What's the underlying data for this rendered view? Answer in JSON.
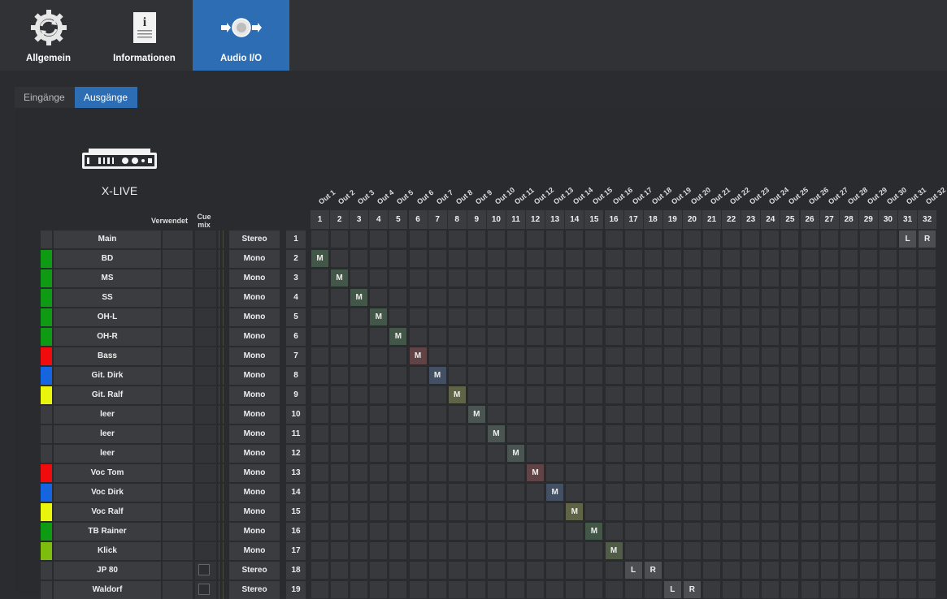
{
  "toolbar": {
    "items": [
      {
        "label": "Allgemein",
        "icon": "sync-gear-icon",
        "active": false
      },
      {
        "label": "Informationen",
        "icon": "info-document-icon",
        "active": false
      },
      {
        "label": "Audio I/O",
        "icon": "audio-io-icon",
        "active": true
      }
    ]
  },
  "tabs": [
    {
      "label": "Eingänge",
      "active": false
    },
    {
      "label": "Ausgänge",
      "active": true
    }
  ],
  "device": {
    "name": "X-LIVE",
    "icon": "rack-device-icon"
  },
  "headers": {
    "used": "Verwendet",
    "cue_mix": "Cue mix"
  },
  "outputs": {
    "labels": [
      "Out 1",
      "Out 2",
      "Out 3",
      "Out 4",
      "Out 5",
      "Out 6",
      "Out 7",
      "Out 8",
      "Out 9",
      "Out 10",
      "Out 11",
      "Out 12",
      "Out 13",
      "Out 14",
      "Out 15",
      "Out 16",
      "Out 17",
      "Out 18",
      "Out 19",
      "Out 20",
      "Out 21",
      "Out 22",
      "Out 23",
      "Out 24",
      "Out 25",
      "Out 26",
      "Out 27",
      "Out 28",
      "Out 29",
      "Out 30",
      "Out 31",
      "Out 32"
    ],
    "numbers": [
      "1",
      "2",
      "3",
      "4",
      "5",
      "6",
      "7",
      "8",
      "9",
      "10",
      "11",
      "12",
      "13",
      "14",
      "15",
      "16",
      "17",
      "18",
      "19",
      "20",
      "21",
      "22",
      "23",
      "24",
      "25",
      "26",
      "27",
      "28",
      "29",
      "30",
      "31",
      "32"
    ]
  },
  "colors": {
    "accent": "#2d6db4",
    "green": "#0f9a14",
    "red": "#f00c0c",
    "blue": "#1565e0",
    "yellow": "#eaf50d",
    "lime": "#7dbd0e"
  },
  "channels": [
    {
      "name": "Main",
      "color": "",
      "mode": "Stereo",
      "num": "1",
      "cue": false,
      "assign": [
        {
          "out": 31,
          "label": "L"
        },
        {
          "out": 32,
          "label": "R"
        }
      ]
    },
    {
      "name": "BD",
      "color": "#0f9a14",
      "mode": "Mono",
      "num": "2",
      "cue": false,
      "assign": [
        {
          "out": 1,
          "label": "M"
        }
      ]
    },
    {
      "name": "MS",
      "color": "#0f9a14",
      "mode": "Mono",
      "num": "3",
      "cue": false,
      "assign": [
        {
          "out": 2,
          "label": "M"
        }
      ]
    },
    {
      "name": "SS",
      "color": "#0f9a14",
      "mode": "Mono",
      "num": "4",
      "cue": false,
      "assign": [
        {
          "out": 3,
          "label": "M"
        }
      ]
    },
    {
      "name": "OH-L",
      "color": "#0f9a14",
      "mode": "Mono",
      "num": "5",
      "cue": false,
      "assign": [
        {
          "out": 4,
          "label": "M"
        }
      ]
    },
    {
      "name": "OH-R",
      "color": "#0f9a14",
      "mode": "Mono",
      "num": "6",
      "cue": false,
      "assign": [
        {
          "out": 5,
          "label": "M"
        }
      ]
    },
    {
      "name": "Bass",
      "color": "#f00c0c",
      "mode": "Mono",
      "num": "7",
      "cue": false,
      "assign": [
        {
          "out": 6,
          "label": "M"
        }
      ]
    },
    {
      "name": "Git. Dirk",
      "color": "#1565e0",
      "mode": "Mono",
      "num": "8",
      "cue": false,
      "assign": [
        {
          "out": 7,
          "label": "M"
        }
      ]
    },
    {
      "name": "Git. Ralf",
      "color": "#eaf50d",
      "mode": "Mono",
      "num": "9",
      "cue": false,
      "assign": [
        {
          "out": 8,
          "label": "M"
        }
      ]
    },
    {
      "name": "leer",
      "color": "",
      "mode": "Mono",
      "num": "10",
      "cue": false,
      "assign": [
        {
          "out": 9,
          "label": "M"
        }
      ]
    },
    {
      "name": "leer",
      "color": "",
      "mode": "Mono",
      "num": "11",
      "cue": false,
      "assign": [
        {
          "out": 10,
          "label": "M"
        }
      ]
    },
    {
      "name": "leer",
      "color": "",
      "mode": "Mono",
      "num": "12",
      "cue": false,
      "assign": [
        {
          "out": 11,
          "label": "M"
        }
      ]
    },
    {
      "name": "Voc Tom",
      "color": "#f00c0c",
      "mode": "Mono",
      "num": "13",
      "cue": false,
      "assign": [
        {
          "out": 12,
          "label": "M"
        }
      ]
    },
    {
      "name": "Voc Dirk",
      "color": "#1565e0",
      "mode": "Mono",
      "num": "14",
      "cue": false,
      "assign": [
        {
          "out": 13,
          "label": "M"
        }
      ]
    },
    {
      "name": "Voc Ralf",
      "color": "#eaf50d",
      "mode": "Mono",
      "num": "15",
      "cue": false,
      "assign": [
        {
          "out": 14,
          "label": "M"
        }
      ]
    },
    {
      "name": "TB Rainer",
      "color": "#0f9a14",
      "mode": "Mono",
      "num": "16",
      "cue": false,
      "assign": [
        {
          "out": 15,
          "label": "M"
        }
      ]
    },
    {
      "name": "Klick",
      "color": "#7dbd0e",
      "mode": "Mono",
      "num": "17",
      "cue": false,
      "assign": [
        {
          "out": 16,
          "label": "M"
        }
      ]
    },
    {
      "name": "JP 80",
      "color": "",
      "mode": "Stereo",
      "num": "18",
      "cue": true,
      "assign": [
        {
          "out": 17,
          "label": "L"
        },
        {
          "out": 18,
          "label": "R"
        }
      ]
    },
    {
      "name": "Waldorf",
      "color": "",
      "mode": "Stereo",
      "num": "19",
      "cue": true,
      "assign": [
        {
          "out": 19,
          "label": "L"
        },
        {
          "out": 20,
          "label": "R"
        }
      ]
    }
  ]
}
